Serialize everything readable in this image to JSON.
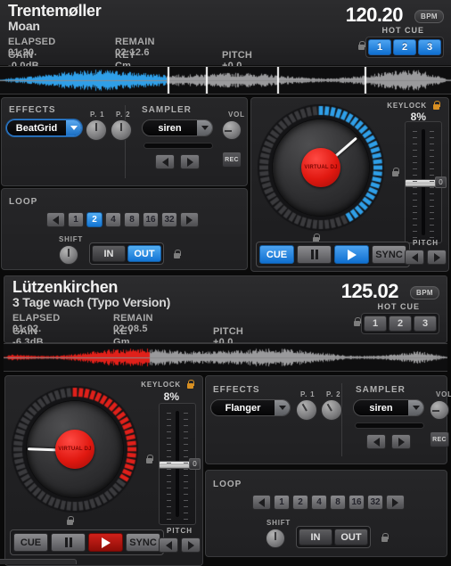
{
  "app": {
    "jog_hub_label": "VIRTUAL DJ"
  },
  "decks": [
    {
      "id": "a",
      "accent": "#1274d4",
      "artist": "Trentemøller",
      "title": "Moan",
      "elapsed_label": "ELAPSED 01:20.",
      "remain_label": "REMAIN 02:12.6",
      "gain_label": "GAIN -0.0dB",
      "key_label": "KEY Cm",
      "pitch_label": "PITCH +0.0",
      "bpm": "120.20",
      "bpm_tag": "BPM",
      "hotcue_label": "HOT CUE",
      "hotcues": [
        {
          "label": "1",
          "active": true
        },
        {
          "label": "2",
          "active": true
        },
        {
          "label": "3",
          "active": true
        }
      ],
      "effects": {
        "label": "EFFECTS",
        "selected": "BeatGrid",
        "highlighted": true,
        "p1_label": "P. 1",
        "p2_label": "P. 2"
      },
      "sampler": {
        "label": "SAMPLER",
        "selected": "siren",
        "vol_label": "VOL",
        "rec_label": "REC",
        "prev_icon": "triangle-left-icon",
        "next_icon": "triangle-right-icon"
      },
      "loop": {
        "label": "LOOP",
        "sizes": [
          "1",
          "2",
          "4",
          "8",
          "16",
          "32"
        ],
        "active_size": "2",
        "shift_label": "SHIFT",
        "in_label": "IN",
        "out_label": "OUT",
        "in_active": false,
        "out_active": true
      },
      "jog": {
        "keylock_label": "KEYLOCK",
        "pitch_percent": "8%",
        "pitch_label": "PITCH",
        "zero_label": "0",
        "needle_angle": -41,
        "ring_lit_degrees": 155
      },
      "transport": {
        "cue_label": "CUE",
        "pause_icon": "pause-icon",
        "play_icon": "play-icon",
        "sync_label": "SYNC",
        "cue_active": true,
        "play_active": true
      },
      "waveform": {
        "played_color": "#2f9fe8",
        "remaining_color": "#9a9a9c",
        "played_fraction": 0.37,
        "cue_markers": [
          0.372,
          0.458,
          0.615,
          0.81
        ]
      }
    },
    {
      "id": "b",
      "accent": "#c0201a",
      "artist": "Lützenkirchen",
      "title": "3 Tage wach (Typo Version)",
      "elapsed_label": "ELAPSED 01:02.",
      "remain_label": "REMAIN 02:08.5",
      "gain_label": "GAIN -6.3dB",
      "key_label": "KEY Gm",
      "pitch_label": "PITCH +0.0",
      "bpm": "125.02",
      "bpm_tag": "BPM",
      "hotcue_label": "HOT CUE",
      "hotcues": [
        {
          "label": "1",
          "active": false
        },
        {
          "label": "2",
          "active": false
        },
        {
          "label": "3",
          "active": false
        }
      ],
      "effects": {
        "label": "EFFECTS",
        "selected": "Flanger",
        "highlighted": false,
        "p1_label": "P. 1",
        "p2_label": "P. 2"
      },
      "sampler": {
        "label": "SAMPLER",
        "selected": "siren",
        "vol_label": "VOL",
        "rec_label": "REC",
        "prev_icon": "triangle-left-icon",
        "next_icon": "triangle-right-icon"
      },
      "loop": {
        "label": "LOOP",
        "sizes": [
          "1",
          "2",
          "4",
          "8",
          "16",
          "32"
        ],
        "active_size": null,
        "shift_label": "SHIFT",
        "in_label": "IN",
        "out_label": "OUT",
        "in_active": false,
        "out_active": false
      },
      "jog": {
        "keylock_label": "KEYLOCK",
        "pitch_percent": "8%",
        "pitch_label": "PITCH",
        "zero_label": "0",
        "needle_angle": 182,
        "ring_lit_degrees": 120
      },
      "transport": {
        "cue_label": "CUE",
        "pause_icon": "pause-icon",
        "play_icon": "play-icon",
        "sync_label": "SYNC",
        "cue_active": false,
        "play_active": true
      },
      "waveform": {
        "played_color": "#e0201a",
        "remaining_color": "#9a9a9c",
        "played_fraction": 0.33,
        "cue_markers": []
      }
    }
  ]
}
